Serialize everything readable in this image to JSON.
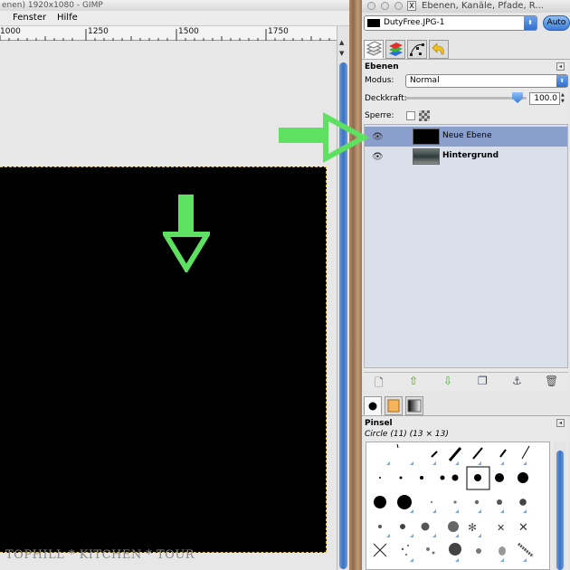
{
  "left_window": {
    "title": "enen) 1920x1080 - GIMP",
    "menus": [
      "Fenster",
      "Hilfe"
    ],
    "ruler_labels": [
      "1000",
      "1250",
      "1500",
      "1750"
    ],
    "watermark": "TOPHILL * KITCHEN * TOUR"
  },
  "dock": {
    "title": "Ebenen, Kanäle, Pfade, R...",
    "image_select": "DutyFree.JPG-1",
    "auto_label": "Auto",
    "tabs": [
      "layers-tab",
      "channels-tab",
      "paths-tab",
      "undo-tab"
    ],
    "layers_panel": {
      "title": "Ebenen",
      "mode_label": "Modus:",
      "mode_value": "Normal",
      "opacity_label": "Deckkraft:",
      "opacity_value": "100.0",
      "opacity_percent": 100,
      "lock_label": "Sperre:",
      "layers": [
        {
          "name": "Neue Ebene",
          "selected": true
        },
        {
          "name": "Hintergrund",
          "selected": false
        }
      ],
      "buttons": [
        "new-layer-icon",
        "raise-layer-icon",
        "lower-layer-icon",
        "duplicate-layer-icon",
        "anchor-layer-icon",
        "delete-layer-icon"
      ]
    },
    "brush_panel": {
      "title": "Pinsel",
      "current_brush": "Circle (11) (13 × 13)"
    }
  },
  "colors": {
    "arrow_green": "#5ee060",
    "selected_layer": "#8b9fcc",
    "layer_list_bg": "#d9e0ea"
  }
}
